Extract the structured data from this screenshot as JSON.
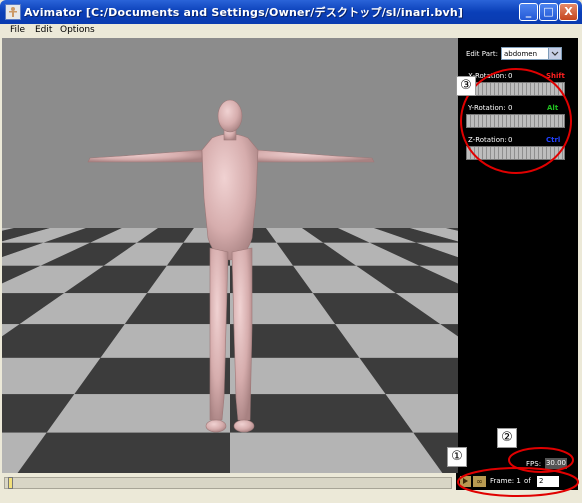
{
  "window": {
    "title": "Avimator [C:/Documents and Settings/Owner/デスクトップ/sl/inari.bvh]",
    "buttons": {
      "minimize": "_",
      "maximize": "□",
      "close": "X"
    }
  },
  "menu": {
    "items": [
      "File",
      "Edit",
      "Options"
    ]
  },
  "panel": {
    "edit_part_label": "Edit Part:",
    "edit_part_value": "abdomen",
    "rotations": [
      {
        "label": "X-Rotation:",
        "value": "0",
        "key": "Shift",
        "color": "#ff2020"
      },
      {
        "label": "Y-Rotation:",
        "value": "0",
        "key": "Alt",
        "color": "#20c020"
      },
      {
        "label": "Z-Rotation:",
        "value": "0",
        "key": "Ctrl",
        "color": "#2040ff"
      }
    ],
    "fps_label": "FPS:",
    "fps_value": "30.00"
  },
  "playback": {
    "frame_label": "Frame: 1",
    "of_label": "of",
    "total_frames": "2"
  },
  "annotations": {
    "callout_1": "①",
    "callout_2": "②",
    "callout_3": "③",
    "highlight_color": "#e00000"
  },
  "scene": {
    "floor_light": "#b4b4b4",
    "floor_dark": "#3c3c3c",
    "sky": "#8c8c8c",
    "figure_color": "#d9b2b2"
  }
}
